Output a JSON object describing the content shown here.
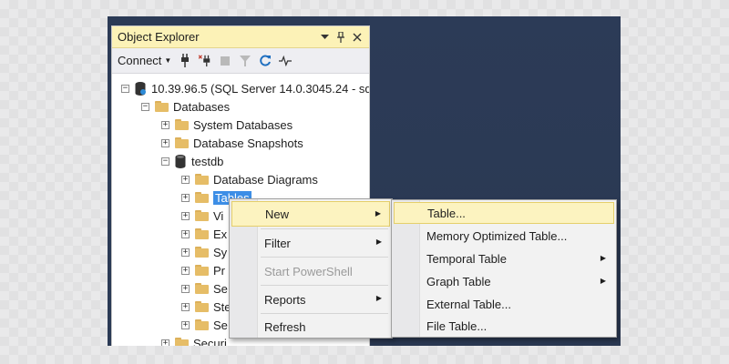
{
  "object_explorer": {
    "title": "Object Explorer",
    "title_buttons": [
      "pin-dropdown",
      "pin",
      "close"
    ],
    "toolbar": {
      "connect_label": "Connect",
      "icons": [
        "connect-plug-icon",
        "disconnect-icon",
        "stop-icon",
        "filter-icon",
        "refresh-icon",
        "activity-monitor-icon"
      ]
    },
    "tree": {
      "server": "10.39.96.5 (SQL Server 14.0.3045.24 - sq",
      "databases": "Databases",
      "system_databases": "System Databases",
      "database_snapshots": "Database Snapshots",
      "testdb": "testdb",
      "database_diagrams": "Database Diagrams",
      "tables": "Tables",
      "truncated_items": [
        "Vi",
        "Ex",
        "Sy",
        "Pr",
        "Se",
        "Ste",
        "Se"
      ],
      "last_partial": "Securi"
    }
  },
  "context_menu": {
    "items": [
      {
        "label": "New",
        "submenu": true,
        "highlighted": true,
        "disabled": false
      },
      {
        "label": "Filter",
        "submenu": true,
        "highlighted": false,
        "disabled": false
      },
      {
        "label": "Start PowerShell",
        "submenu": false,
        "highlighted": false,
        "disabled": true
      },
      {
        "label": "Reports",
        "submenu": true,
        "highlighted": false,
        "disabled": false
      },
      {
        "label": "Refresh",
        "submenu": false,
        "highlighted": false,
        "disabled": false
      }
    ]
  },
  "submenu_new": {
    "items": [
      {
        "label": "Table...",
        "submenu": false,
        "highlighted": true
      },
      {
        "label": "Memory Optimized Table...",
        "submenu": false,
        "highlighted": false
      },
      {
        "label": "Temporal Table",
        "submenu": true,
        "highlighted": false
      },
      {
        "label": "Graph Table",
        "submenu": true,
        "highlighted": false
      },
      {
        "label": "External Table...",
        "submenu": false,
        "highlighted": false
      },
      {
        "label": "File Table...",
        "submenu": false,
        "highlighted": false
      }
    ]
  },
  "colors": {
    "title_bar": "#fcf2b7",
    "highlight": "#fcf3c0",
    "selection": "#3d8ee6",
    "workspace": "#2b3a55",
    "folder": "#e6bd67"
  }
}
